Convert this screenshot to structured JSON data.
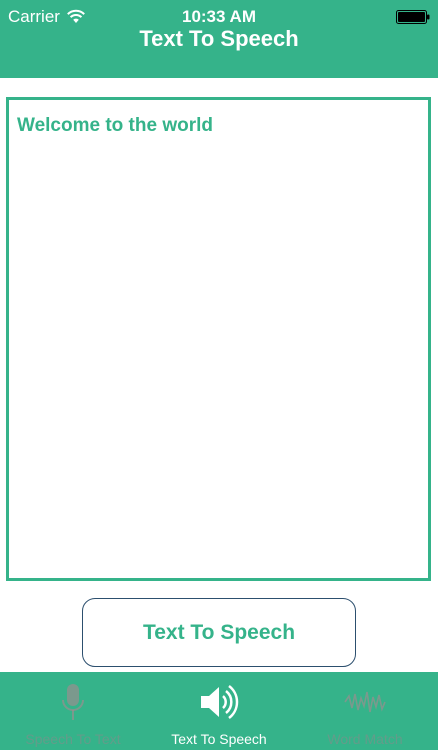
{
  "status_bar": {
    "carrier": "Carrier",
    "time": "10:33 AM"
  },
  "header": {
    "title": "Text To Speech"
  },
  "text_box": {
    "value": "Welcome to the world"
  },
  "action_button": {
    "label": "Text To Speech"
  },
  "tab_bar": {
    "tabs": [
      {
        "label": "Speech To Text",
        "icon": "microphone-icon",
        "selected": false
      },
      {
        "label": "Text To Speech",
        "icon": "speaker-icon",
        "selected": true
      },
      {
        "label": "Word Match",
        "icon": "waveform-icon",
        "selected": false
      }
    ]
  },
  "colors": {
    "accent": "#35b38a",
    "button_border": "#2c4f6e",
    "text_on_accent": "#ffffff",
    "inactive_tab": "#8a8a8a"
  }
}
